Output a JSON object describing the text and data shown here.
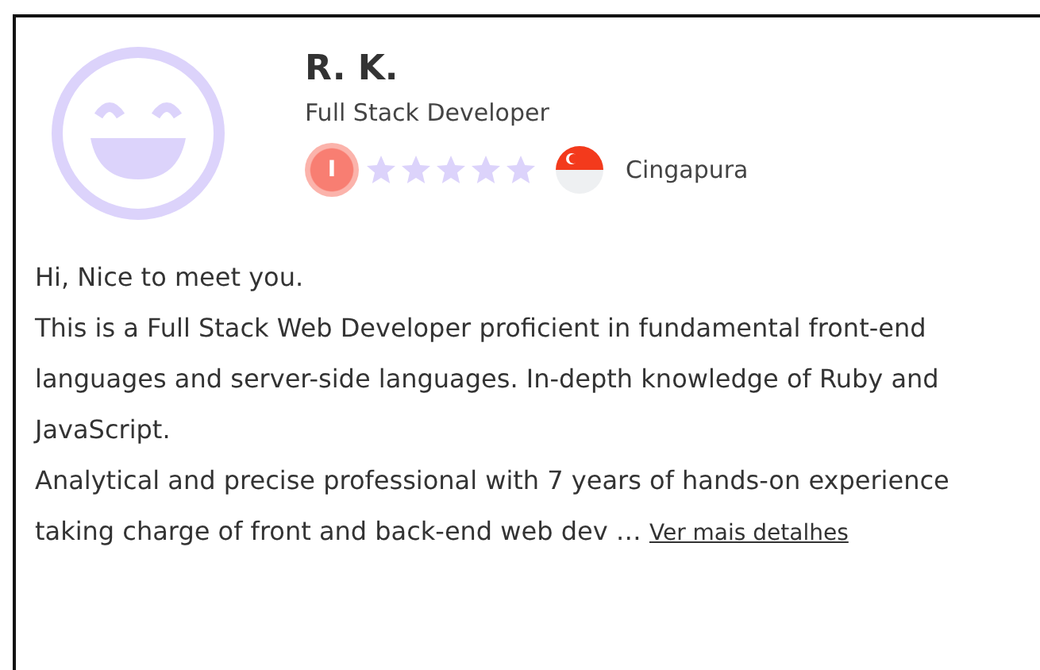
{
  "profile": {
    "name": "R. K.",
    "title": "Full Stack Developer",
    "badge": "I",
    "country": "Cingapura"
  },
  "bio": [
    "Hi, Nice to meet you.",
    "This is a Full Stack Web Developer proficient in fundamental front-end languages and server-side languages. In-depth knowledge of Ruby and JavaScript.",
    "Analytical and precise professional with 7 years of hands-on experience taking charge of front and back-end web dev …"
  ],
  "more_link": "Ver mais detalhes"
}
